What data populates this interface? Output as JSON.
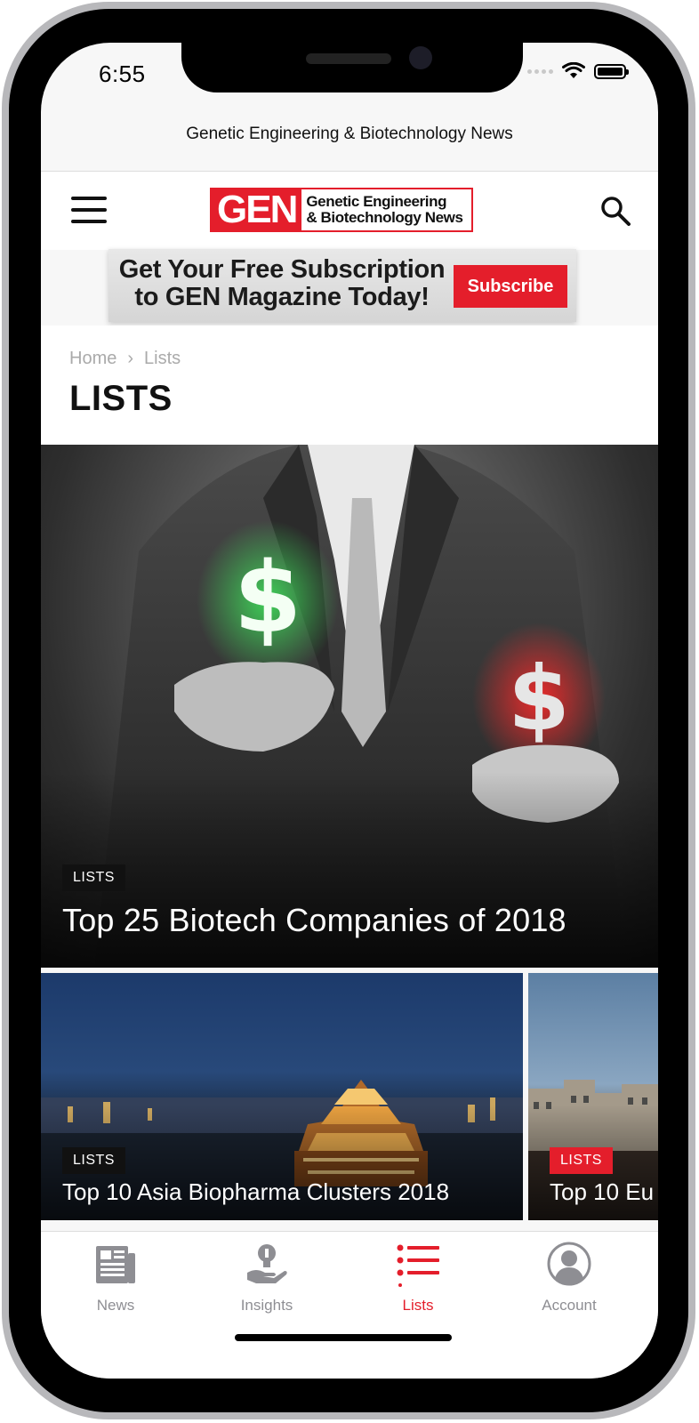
{
  "status_bar": {
    "time": "6:55"
  },
  "browser": {
    "page_title": "Genetic Engineering & Biotechnology News"
  },
  "header": {
    "logo_mark": "GEN",
    "logo_line1": "Genetic Engineering",
    "logo_line2": "& Biotechnology News"
  },
  "ad": {
    "line1": "Get Your Free Subscription",
    "line2": "to GEN Magazine Today!",
    "button_label": "Subscribe"
  },
  "breadcrumb": {
    "home": "Home",
    "separator": "›",
    "current": "Lists"
  },
  "page_heading": "LISTS",
  "hero": {
    "tag": "LISTS",
    "title": "Top 25 Biotech Companies of 2018"
  },
  "cards": [
    {
      "tag": "LISTS",
      "title": "Top 10 Asia Biopharma Clusters 2018"
    },
    {
      "tag": "LISTS",
      "title": "Top 10 Eu"
    }
  ],
  "tabs": [
    {
      "label": "News",
      "icon": "newspaper-icon"
    },
    {
      "label": "Insights",
      "icon": "lightbulb-hand-icon"
    },
    {
      "label": "Lists",
      "icon": "list-icon",
      "active": true
    },
    {
      "label": "Account",
      "icon": "user-icon"
    }
  ],
  "colors": {
    "brand_red": "#e41e2b",
    "tab_inactive": "#8e8e93"
  }
}
